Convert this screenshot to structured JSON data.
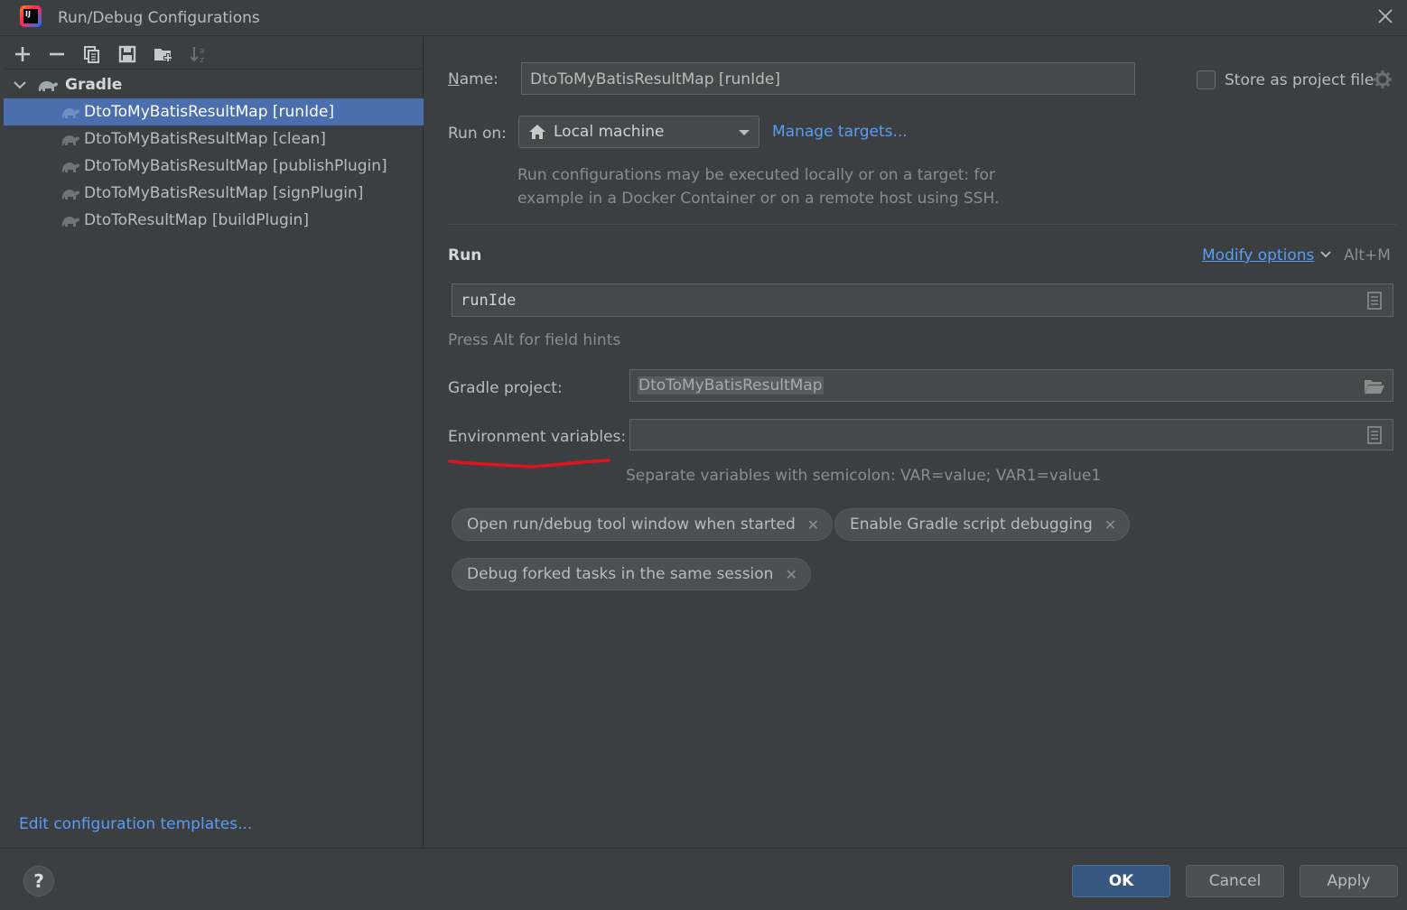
{
  "window": {
    "title": "Run/Debug Configurations"
  },
  "tree": {
    "group_label": "Gradle",
    "items": [
      {
        "label": "DtoToMyBatisResultMap [runIde]",
        "selected": true
      },
      {
        "label": "DtoToMyBatisResultMap [clean]",
        "selected": false
      },
      {
        "label": "DtoToMyBatisResultMap [publishPlugin]",
        "selected": false
      },
      {
        "label": "DtoToMyBatisResultMap [signPlugin]",
        "selected": false
      },
      {
        "label": "DtoToResultMap [buildPlugin]",
        "selected": false
      }
    ]
  },
  "left_footer": {
    "edit_templates": "Edit configuration templates..."
  },
  "form": {
    "name_label": "Name:",
    "name_value": "DtoToMyBatisResultMap [runIde]",
    "store_label": "Store as project file",
    "run_on_label": "Run on:",
    "run_on_value": "Local machine",
    "manage_targets": "Manage targets...",
    "run_on_hint_1": "Run configurations may be executed locally or on a target: for",
    "run_on_hint_2": "example in a Docker Container or on a remote host using SSH.",
    "run_section": "Run",
    "modify_options": "Modify options",
    "modify_shortcut": "Alt+M",
    "tasks_value": "runIde",
    "field_hint": "Press Alt for field hints",
    "gradle_project_label": "Gradle project:",
    "gradle_project_value": "DtoToMyBatisResultMap",
    "env_label": "Environment variables:",
    "env_value": "",
    "env_hint": "Separate variables with semicolon: VAR=value; VAR1=value1"
  },
  "chips": [
    "Open run/debug tool window when started",
    "Enable Gradle script debugging",
    "Debug forked tasks in the same session"
  ],
  "buttons": {
    "help": "?",
    "ok": "OK",
    "cancel": "Cancel",
    "apply": "Apply"
  },
  "colors": {
    "accent": "#589df6",
    "selection": "#4b6eaf",
    "annotation": "#e0141e"
  }
}
